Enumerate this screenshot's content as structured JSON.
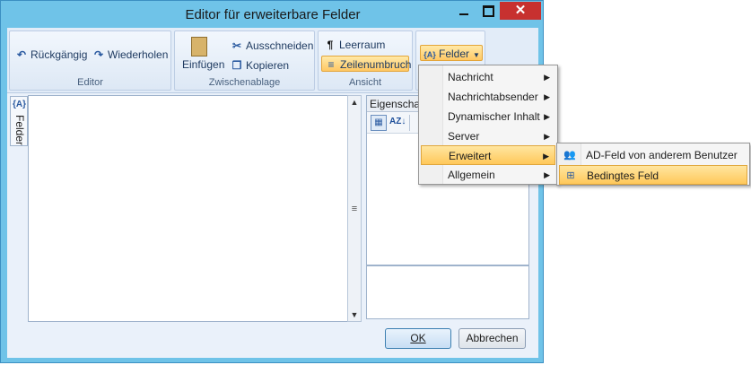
{
  "window": {
    "title": "Editor für erweiterbare Felder",
    "close_glyph": "✕"
  },
  "ribbon": {
    "editor": {
      "undo": "Rückgängig",
      "redo": "Wiederholen",
      "label": "Editor"
    },
    "clipboard": {
      "paste": "Einfügen",
      "cut": "Ausschneiden",
      "copy": "Kopieren",
      "label": "Zwischenablage"
    },
    "view": {
      "whitespace": "Leerraum",
      "wrap": "Zeilenumbruch",
      "label": "Ansicht"
    },
    "fields": {
      "button": "Felder",
      "icon_text": "{A}"
    }
  },
  "side_tab": {
    "label": "Felder",
    "icon_text": "{A}"
  },
  "properties": {
    "header": "Eigenschaften"
  },
  "buttons": {
    "ok": "OK",
    "cancel": "Abbrechen"
  },
  "menu": {
    "items": [
      {
        "label": "Nachricht"
      },
      {
        "label": "Nachrichtabsender"
      },
      {
        "label": "Dynamischer Inhalt"
      },
      {
        "label": "Server"
      },
      {
        "label": "Erweitert",
        "selected": true
      },
      {
        "label": "Allgemein"
      }
    ]
  },
  "submenu": {
    "items": [
      {
        "label": "AD-Feld von anderem Benutzer",
        "icon": "users-icon"
      },
      {
        "label": "Bedingtes Feld",
        "icon": "conditional-field-icon",
        "selected": true
      }
    ]
  },
  "colors": {
    "accent": "#ffc85a",
    "title_bar": "#6fc3e8",
    "close": "#c7312f"
  }
}
